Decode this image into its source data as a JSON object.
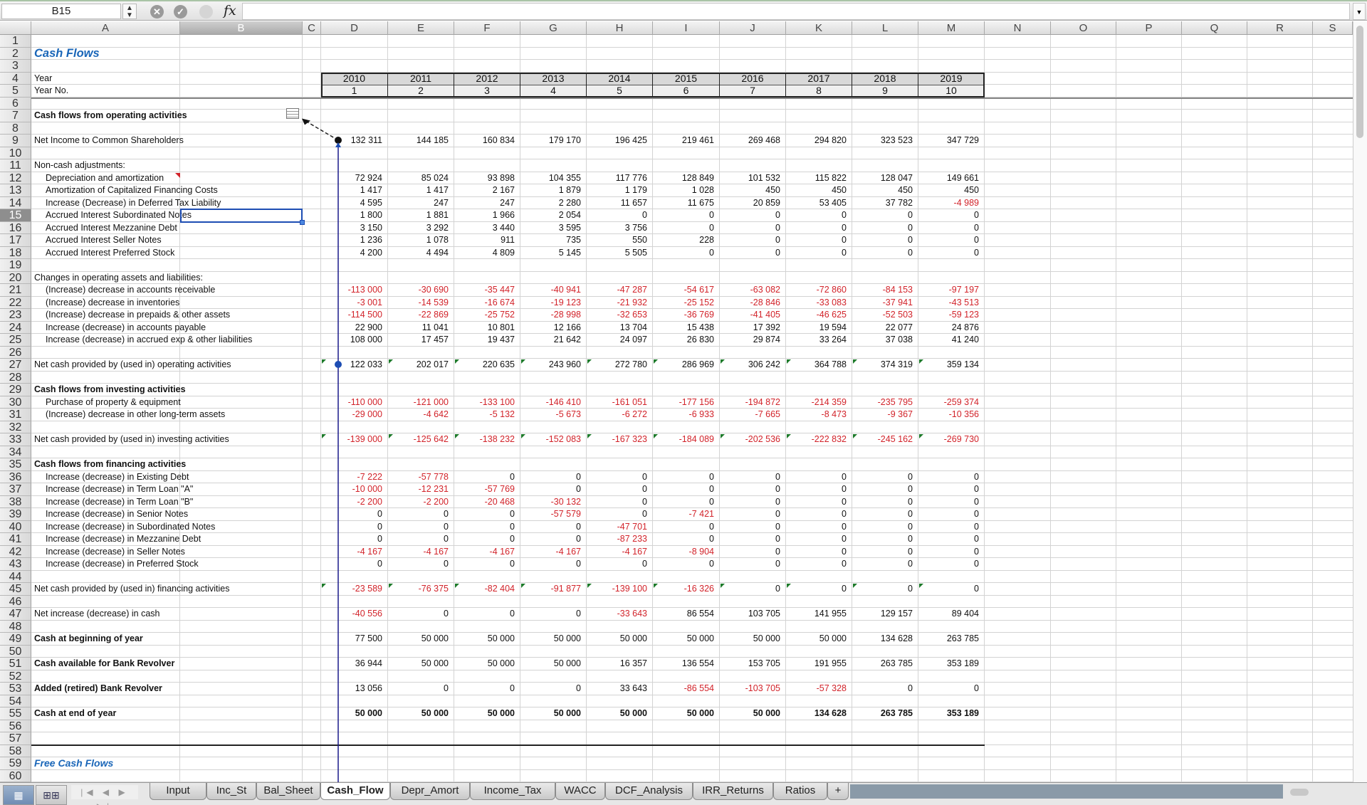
{
  "formula_bar": {
    "name_box": "B15",
    "spin_label": "▲▼",
    "cancel_icon": "✕",
    "accept_icon": "✓",
    "fx_label": "fx",
    "formula": "",
    "dropdown_icon": "▼"
  },
  "columns": [
    "A",
    "B",
    "C",
    "D",
    "E",
    "F",
    "G",
    "H",
    "I",
    "J",
    "K",
    "L",
    "M",
    "N",
    "O",
    "P",
    "Q",
    "R",
    "S"
  ],
  "selected_column": "B",
  "selected_row": 15,
  "title": "Cash Flows",
  "year_label": "Year",
  "year_no_label": "Year No.",
  "years": [
    "2010",
    "2011",
    "2012",
    "2013",
    "2014",
    "2015",
    "2016",
    "2017",
    "2018",
    "2019"
  ],
  "year_nos": [
    "1",
    "2",
    "3",
    "4",
    "5",
    "6",
    "7",
    "8",
    "9",
    "10"
  ],
  "rows": [
    {
      "row": 7,
      "label": "Cash flows from operating activities",
      "style": "bold",
      "values": []
    },
    {
      "row": 9,
      "label": "Net Income to Common Shareholders",
      "values": [
        "132 311",
        "144 185",
        "160 834",
        "179 170",
        "196 425",
        "219 461",
        "269 468",
        "294 820",
        "323 523",
        "347 729"
      ]
    },
    {
      "row": 11,
      "label": "Non-cash adjustments:",
      "values": []
    },
    {
      "row": 12,
      "label": "Depreciation and amortization",
      "indent": true,
      "values": [
        "72 924",
        "85 024",
        "93 898",
        "104 355",
        "117 776",
        "128 849",
        "101 532",
        "115 822",
        "128 047",
        "149 661"
      ]
    },
    {
      "row": 13,
      "label": "Amortization of Capitalized Financing Costs",
      "indent": true,
      "values": [
        "1 417",
        "1 417",
        "2 167",
        "1 879",
        "1 179",
        "1 028",
        "450",
        "450",
        "450",
        "450"
      ]
    },
    {
      "row": 14,
      "label": "Increase (Decrease) in Deferred Tax Liability",
      "indent": true,
      "values": [
        "4 595",
        "247",
        "247",
        "2 280",
        "11 657",
        "11 675",
        "20 859",
        "53 405",
        "37 782",
        "-4 989"
      ]
    },
    {
      "row": 15,
      "label": "Accrued Interest Subordinated Notes",
      "indent": true,
      "values": [
        "1 800",
        "1 881",
        "1 966",
        "2 054",
        "0",
        "0",
        "0",
        "0",
        "0",
        "0"
      ]
    },
    {
      "row": 16,
      "label": "Accrued Interest Mezzanine Debt",
      "indent": true,
      "values": [
        "3 150",
        "3 292",
        "3 440",
        "3 595",
        "3 756",
        "0",
        "0",
        "0",
        "0",
        "0"
      ]
    },
    {
      "row": 17,
      "label": "Accrued Interest Seller Notes",
      "indent": true,
      "values": [
        "1 236",
        "1 078",
        "911",
        "735",
        "550",
        "228",
        "0",
        "0",
        "0",
        "0"
      ]
    },
    {
      "row": 18,
      "label": "Accrued Interest Preferred Stock",
      "indent": true,
      "values": [
        "4 200",
        "4 494",
        "4 809",
        "5 145",
        "5 505",
        "0",
        "0",
        "0",
        "0",
        "0"
      ]
    },
    {
      "row": 20,
      "label": "Changes in operating assets and liabilities:",
      "values": []
    },
    {
      "row": 21,
      "label": "(Increase) decrease in accounts receivable",
      "indent": true,
      "values": [
        "-113 000",
        "-30 690",
        "-35 447",
        "-40 941",
        "-47 287",
        "-54 617",
        "-63 082",
        "-72 860",
        "-84 153",
        "-97 197"
      ]
    },
    {
      "row": 22,
      "label": "(Increase) decrease in inventories",
      "indent": true,
      "values": [
        "-3 001",
        "-14 539",
        "-16 674",
        "-19 123",
        "-21 932",
        "-25 152",
        "-28 846",
        "-33 083",
        "-37 941",
        "-43 513"
      ]
    },
    {
      "row": 23,
      "label": "(Increase) decrease in prepaids & other assets",
      "indent": true,
      "values": [
        "-114 500",
        "-22 869",
        "-25 752",
        "-28 998",
        "-32 653",
        "-36 769",
        "-41 405",
        "-46 625",
        "-52 503",
        "-59 123"
      ]
    },
    {
      "row": 24,
      "label": "Increase (decrease) in accounts payable",
      "indent": true,
      "values": [
        "22 900",
        "11 041",
        "10 801",
        "12 166",
        "13 704",
        "15 438",
        "17 392",
        "19 594",
        "22 077",
        "24 876"
      ]
    },
    {
      "row": 25,
      "label": "Increase (decrease) in accrued exp & other liabilities",
      "indent": true,
      "values": [
        "108 000",
        "17 457",
        "19 437",
        "21 642",
        "24 097",
        "26 830",
        "29 874",
        "33 264",
        "37 038",
        "41 240"
      ]
    },
    {
      "row": 27,
      "label": "Net cash provided by (used in) operating activities",
      "flag": true,
      "values": [
        "122 033",
        "202 017",
        "220 635",
        "243 960",
        "272 780",
        "286 969",
        "306 242",
        "364 788",
        "374 319",
        "359 134"
      ]
    },
    {
      "row": 29,
      "label": "Cash flows from investing activities",
      "style": "bold",
      "values": []
    },
    {
      "row": 30,
      "label": "Purchase of property & equipment",
      "indent": true,
      "values": [
        "-110 000",
        "-121 000",
        "-133 100",
        "-146 410",
        "-161 051",
        "-177 156",
        "-194 872",
        "-214 359",
        "-235 795",
        "-259 374"
      ]
    },
    {
      "row": 31,
      "label": "(Increase) decrease in other long-term assets",
      "indent": true,
      "values": [
        "-29 000",
        "-4 642",
        "-5 132",
        "-5 673",
        "-6 272",
        "-6 933",
        "-7 665",
        "-8 473",
        "-9 367",
        "-10 356"
      ]
    },
    {
      "row": 33,
      "label": "Net cash provided by (used in) investing activities",
      "flag": true,
      "values": [
        "-139 000",
        "-125 642",
        "-138 232",
        "-152 083",
        "-167 323",
        "-184 089",
        "-202 536",
        "-222 832",
        "-245 162",
        "-269 730"
      ]
    },
    {
      "row": 35,
      "label": "Cash flows from financing activities",
      "style": "bold",
      "values": []
    },
    {
      "row": 36,
      "label": "Increase (decrease) in Existing Debt",
      "indent": true,
      "values": [
        "-7 222",
        "-57 778",
        "0",
        "0",
        "0",
        "0",
        "0",
        "0",
        "0",
        "0"
      ]
    },
    {
      "row": 37,
      "label": "Increase (decrease) in Term Loan \"A\"",
      "indent": true,
      "values": [
        "-10 000",
        "-12 231",
        "-57 769",
        "0",
        "0",
        "0",
        "0",
        "0",
        "0",
        "0"
      ]
    },
    {
      "row": 38,
      "label": "Increase (decrease) in Term Loan \"B\"",
      "indent": true,
      "values": [
        "-2 200",
        "-2 200",
        "-20 468",
        "-30 132",
        "0",
        "0",
        "0",
        "0",
        "0",
        "0"
      ]
    },
    {
      "row": 39,
      "label": "Increase (decrease) in Senior Notes",
      "indent": true,
      "values": [
        "0",
        "0",
        "0",
        "-57 579",
        "0",
        "-7 421",
        "0",
        "0",
        "0",
        "0"
      ]
    },
    {
      "row": 40,
      "label": "Increase (decrease) in Subordinated Notes",
      "indent": true,
      "values": [
        "0",
        "0",
        "0",
        "0",
        "-47 701",
        "0",
        "0",
        "0",
        "0",
        "0"
      ]
    },
    {
      "row": 41,
      "label": "Increase (decrease) in Mezzanine Debt",
      "indent": true,
      "values": [
        "0",
        "0",
        "0",
        "0",
        "-87 233",
        "0",
        "0",
        "0",
        "0",
        "0"
      ]
    },
    {
      "row": 42,
      "label": "Increase (decrease) in Seller Notes",
      "indent": true,
      "values": [
        "-4 167",
        "-4 167",
        "-4 167",
        "-4 167",
        "-4 167",
        "-8 904",
        "0",
        "0",
        "0",
        "0"
      ]
    },
    {
      "row": 43,
      "label": "Increase (decrease) in Preferred Stock",
      "indent": true,
      "values": [
        "0",
        "0",
        "0",
        "0",
        "0",
        "0",
        "0",
        "0",
        "0",
        "0"
      ]
    },
    {
      "row": 45,
      "label": "Net cash provided by (used in) financing activities",
      "flag": true,
      "values": [
        "-23 589",
        "-76 375",
        "-82 404",
        "-91 877",
        "-139 100",
        "-16 326",
        "0",
        "0",
        "0",
        "0"
      ]
    },
    {
      "row": 47,
      "label": "Net increase (decrease) in cash",
      "values": [
        "-40 556",
        "0",
        "0",
        "0",
        "-33 643",
        "86 554",
        "103 705",
        "141 955",
        "129 157",
        "89 404"
      ]
    },
    {
      "row": 49,
      "label": "Cash at beginning of year",
      "style": "bold",
      "values": [
        "77 500",
        "50 000",
        "50 000",
        "50 000",
        "50 000",
        "50 000",
        "50 000",
        "50 000",
        "134 628",
        "263 785"
      ]
    },
    {
      "row": 51,
      "label": "Cash available for Bank Revolver",
      "style": "bold",
      "values": [
        "36 944",
        "50 000",
        "50 000",
        "50 000",
        "16 357",
        "136 554",
        "153 705",
        "191 955",
        "263 785",
        "353 189"
      ]
    },
    {
      "row": 53,
      "label": "Added (retired) Bank Revolver",
      "style": "bold",
      "values": [
        "13 056",
        "0",
        "0",
        "0",
        "33 643",
        "-86 554",
        "-103 705",
        "-57 328",
        "0",
        "0"
      ]
    },
    {
      "row": 55,
      "label": "Cash at end of year",
      "style": "bold",
      "boldvals": true,
      "values": [
        "50 000",
        "50 000",
        "50 000",
        "50 000",
        "50 000",
        "50 000",
        "50 000",
        "134 628",
        "263 785",
        "353 189"
      ]
    }
  ],
  "free_cash_flows_title": "Free Cash Flows",
  "sheet_tabs": [
    {
      "label": "Input",
      "active": false
    },
    {
      "label": "Inc_St",
      "active": false
    },
    {
      "label": "Bal_Sheet",
      "active": false
    },
    {
      "label": "Cash_Flow",
      "active": true
    },
    {
      "label": "Depr_Amort",
      "active": false
    },
    {
      "label": "Income_Tax",
      "active": false
    },
    {
      "label": "WACC",
      "active": false
    },
    {
      "label": "DCF_Analysis",
      "active": false
    },
    {
      "label": "IRR_Returns",
      "active": false
    },
    {
      "label": "Ratios",
      "active": false
    },
    {
      "label": "+",
      "active": false
    }
  ],
  "nav_arrows": "|◀ ◀ ▶ ▶|",
  "view_buttons": [
    "normal-view",
    "page-layout-view"
  ],
  "colors": {
    "negative": "#d2232a",
    "title": "#1a66b8",
    "selection": "#1d4db3",
    "trace_arrow": "#1a1a8a"
  }
}
